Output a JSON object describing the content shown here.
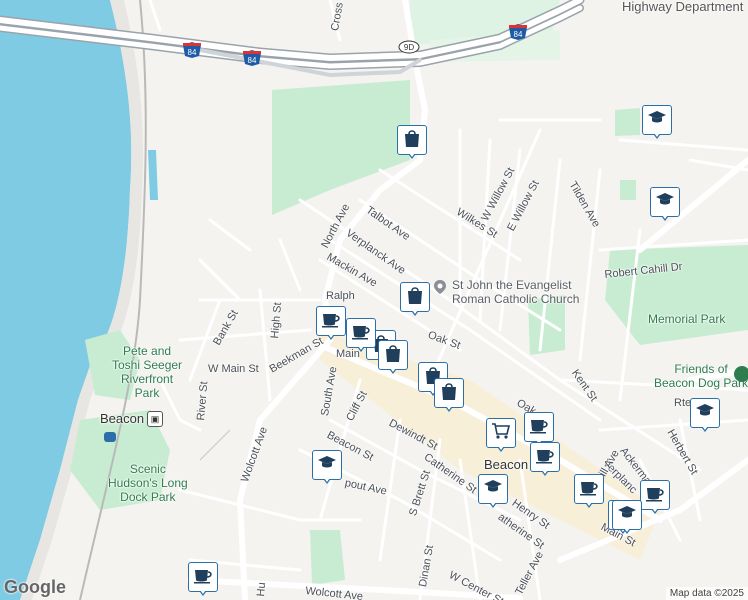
{
  "map": {
    "attribution": "Map data ©2025",
    "logo": "Google",
    "colors": {
      "water": "#7fcbe3",
      "park": "#c8ecd1",
      "road": "#ffffff",
      "highway": "#9aa3ab",
      "marker_border": "#2b6fa8",
      "marker_icon": "#1f3f5c"
    }
  },
  "labels": {
    "highway_department": "Highway Department",
    "cross": "Cross",
    "north_ave": "North Ave",
    "talbot_ave": "Talbot Ave",
    "verplanck_ave": "Verplanck Ave",
    "mackin_ave": "Mackin Ave",
    "ralph": "Ralph",
    "wilkes_st": "Wilkes St",
    "w_willow_st": "W Willow St",
    "e_willow_st": "E Willow St",
    "tilden_ave": "Tilden Ave",
    "robert_cahill_dr": "Robert Cahill Dr",
    "church": "St John the Evangelist\nRoman Catholic Church",
    "memorial_park": "Memorial Park",
    "dog_park": "Friends of\nBeacon Dog Park",
    "pete_toshi": "Pete and\nToshi Seeger\nRiverfront\nPark",
    "beacon_station": "Beacon",
    "scenic_hudson": "Scenic\nHudson's Long\nDock Park",
    "bank_st": "Bank St",
    "high_st": "High St",
    "beekman_st": "Beekman St",
    "w_main_st": "W Main St",
    "river_st": "River St",
    "wolcott_ave": "Wolcott Ave",
    "south_ave": "South Ave",
    "cliff_st": "Cliff St",
    "beacon_st": "Beacon St",
    "dewindt_st": "Dewindt St",
    "catherine_st": "Catherine St",
    "catherine_st2": "atherine St",
    "henry_st": "Henry St",
    "s_brett_st": "S Brett St",
    "dinan_st": "Dinan St",
    "w_center_st": "W Center St",
    "teller_ave": "Teller Ave",
    "kent_st": "Kent St",
    "herbert_st": "Herbert St",
    "ackerman_st": "Ackerman St",
    "verplanck2": "Verplanc",
    "main_st": "Main St",
    "main_st_left": "Main",
    "rte": "Rte",
    "oak_st": "Oak St",
    "oak2": "Oak",
    "pout_ave": "pout Ave",
    "wolcott_ave2": "Wolcott Ave",
    "hu": "Hu",
    "city_beacon": "Beacon",
    "hill_ave": "Hill Ave"
  },
  "shields": {
    "i84_a": "84",
    "i84_b": "84",
    "i84_c": "84",
    "ny9d": "9D"
  },
  "markers": [
    {
      "icon": "graduation-cap-icon"
    },
    {
      "icon": "graduation-cap-icon"
    },
    {
      "icon": "shopping-bag-icon"
    },
    {
      "icon": "shopping-bag-icon"
    },
    {
      "icon": "graduation-cap-icon"
    },
    {
      "icon": "coffee-cup-icon"
    },
    {
      "icon": "shopping-bag-icon"
    },
    {
      "icon": "shopping-bag-icon"
    },
    {
      "icon": "shopping-bag-icon"
    },
    {
      "icon": "shopping-bag-icon"
    },
    {
      "icon": "graduation-cap-icon"
    },
    {
      "icon": "shopping-cart-icon"
    },
    {
      "icon": "coffee-cup-icon"
    },
    {
      "icon": "coffee-cup-icon"
    },
    {
      "icon": "coffee-cup-icon"
    },
    {
      "icon": "coffee-cup-icon"
    },
    {
      "icon": "coffee-cup-icon"
    },
    {
      "icon": "coffee-cup-icon"
    },
    {
      "icon": "graduation-cap-icon"
    },
    {
      "icon": "graduation-cap-icon"
    },
    {
      "icon": "coffee-cup-icon"
    }
  ]
}
